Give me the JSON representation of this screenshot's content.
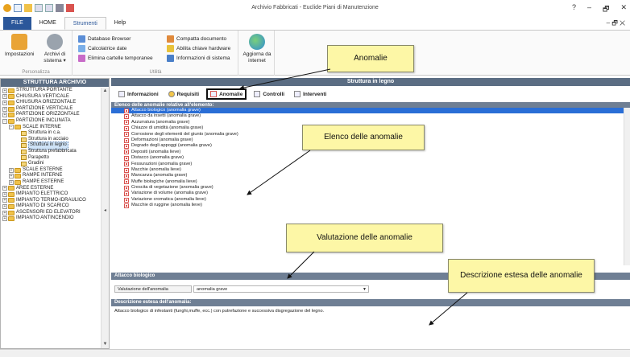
{
  "window": {
    "title": "Archivio Fabbricati - Euclide Piani di Manutenzione",
    "controls": [
      "?",
      "–",
      "🗗",
      "✕"
    ]
  },
  "ribbon_tabs": {
    "file": "FILE",
    "home": "HOME",
    "strumenti": "Strumenti",
    "help": "Help",
    "right": "–  🗗  ✕"
  },
  "ribbon": {
    "personalizza": {
      "title": "Personalizza",
      "impostazioni": "Impostazioni",
      "archivi": "Archivi di sistema ▾"
    },
    "tools": {
      "database_browser": "Database Browser",
      "calcolatrice": "Calcolatrice date",
      "elimina": "Elimina cartelle temporanee",
      "compatta": "Compatta documento",
      "abilita": "Abilita chiave hardware",
      "informazioni": "Informazioni di sistema",
      "title": "Utilità"
    },
    "aggiorna": "Aggiorna da internet"
  },
  "left_panel": {
    "header": "STRUTTURA ARCHIVIO",
    "tree": [
      {
        "label": "STRUTTURA PORTANTE",
        "level": 0,
        "exp": "+",
        "kind": "folder"
      },
      {
        "label": "CHIUSURA VERTICALE",
        "level": 0,
        "exp": "+",
        "kind": "folder"
      },
      {
        "label": "CHIUSURA ORIZZONTALE",
        "level": 0,
        "exp": "+",
        "kind": "folder"
      },
      {
        "label": "PARTIZIONE VERTICALE",
        "level": 0,
        "exp": "+",
        "kind": "folder"
      },
      {
        "label": "PARTIZIONE ORIZZONTALE",
        "level": 0,
        "exp": "+",
        "kind": "folder"
      },
      {
        "label": "PARTIZIONE INCLINATA",
        "level": 0,
        "exp": "−",
        "kind": "folder"
      },
      {
        "label": "SCALE INTERNE",
        "level": 1,
        "exp": "−",
        "kind": "folder"
      },
      {
        "label": "Struttura in c.a.",
        "level": 2,
        "exp": "",
        "kind": "doc"
      },
      {
        "label": "Struttura in acciaio",
        "level": 2,
        "exp": "",
        "kind": "doc"
      },
      {
        "label": "Struttura in legno",
        "level": 2,
        "exp": "",
        "kind": "doc",
        "selected": true
      },
      {
        "label": "Struttura prefabbricata",
        "level": 2,
        "exp": "",
        "kind": "doc"
      },
      {
        "label": "Parapetto",
        "level": 2,
        "exp": "",
        "kind": "doc"
      },
      {
        "label": "Gradini",
        "level": 2,
        "exp": "",
        "kind": "doc"
      },
      {
        "label": "SCALE ESTERNE",
        "level": 1,
        "exp": "+",
        "kind": "folder"
      },
      {
        "label": "RAMPE INTERNE",
        "level": 1,
        "exp": "+",
        "kind": "folder"
      },
      {
        "label": "RAMPE ESTERNE",
        "level": 1,
        "exp": "+",
        "kind": "folder"
      },
      {
        "label": "AREE ESTERNE",
        "level": 0,
        "exp": "+",
        "kind": "folder"
      },
      {
        "label": "IMPIANTO ELETTRICO",
        "level": 0,
        "exp": "+",
        "kind": "folder"
      },
      {
        "label": "IMPIANTO TERMO-IDRAULICO",
        "level": 0,
        "exp": "+",
        "kind": "folder"
      },
      {
        "label": "IMPIANTO DI SCARICO",
        "level": 0,
        "exp": "+",
        "kind": "folder"
      },
      {
        "label": "ASCENSORI ED ELEVATORI",
        "level": 0,
        "exp": "+",
        "kind": "folder"
      },
      {
        "label": "IMPIANTO ANTINCENDIO",
        "level": 0,
        "exp": "+",
        "kind": "folder"
      }
    ]
  },
  "right_panel": {
    "header": "Struttura in legno",
    "subtabs": [
      "Informazioni",
      "Requisiti",
      "Anomalie",
      "Controlli",
      "Interventi"
    ],
    "list_header": "Elenco delle anomalie relative all'elemento:",
    "anomalies": [
      "Attacco biologico (anomalia grave)",
      "Attacco da insetti (anomalia grave)",
      "Azzurratura (anomalia grave)",
      "Chiazze di umidità (anomalia grave)",
      "Corrosione degli elementi del giunto (anomalia grave)",
      "Deformazioni (anomalia grave)",
      "Degrado degli appoggi (anomalia grave)",
      "Depositi (anomalia lieve)",
      "Distacco (anomalia grave)",
      "Fessurazioni (anomalia grave)",
      "Macchie (anomalia lieve)",
      "Mancanza (anomalia grave)",
      "Muffe biologiche (anomalia lieve)",
      "Crescita di vegetazione (anomalia grave)",
      "Variazione di volume (anomalia grave)",
      "Variazione cromatica (anomalia lieve)",
      "Macchie di ruggine (anomalia lieve)"
    ],
    "selected_header": "Attacco biologico",
    "valutazione_label": "Valutazione dell'anomalia",
    "valutazione_value": "anomalia grave",
    "desc_header": "Descrizione estesa dell'anomalia:",
    "desc_text": "Attacco biologico di infestanti (funghi,muffe, ecc.) con putrefazione e successiva disgregazione del legno."
  },
  "callouts": {
    "anomalie": "Anomalie",
    "elenco": "Elenco delle anomalie",
    "valutazione": "Valutazione delle anomalie",
    "descrizione": "Descrizione estesa delle anomalie"
  },
  "colors": {
    "accent": "#2b579a",
    "header": "#5b6d83",
    "callout": "#fdf7a6",
    "selection": "#2a6ed6"
  }
}
